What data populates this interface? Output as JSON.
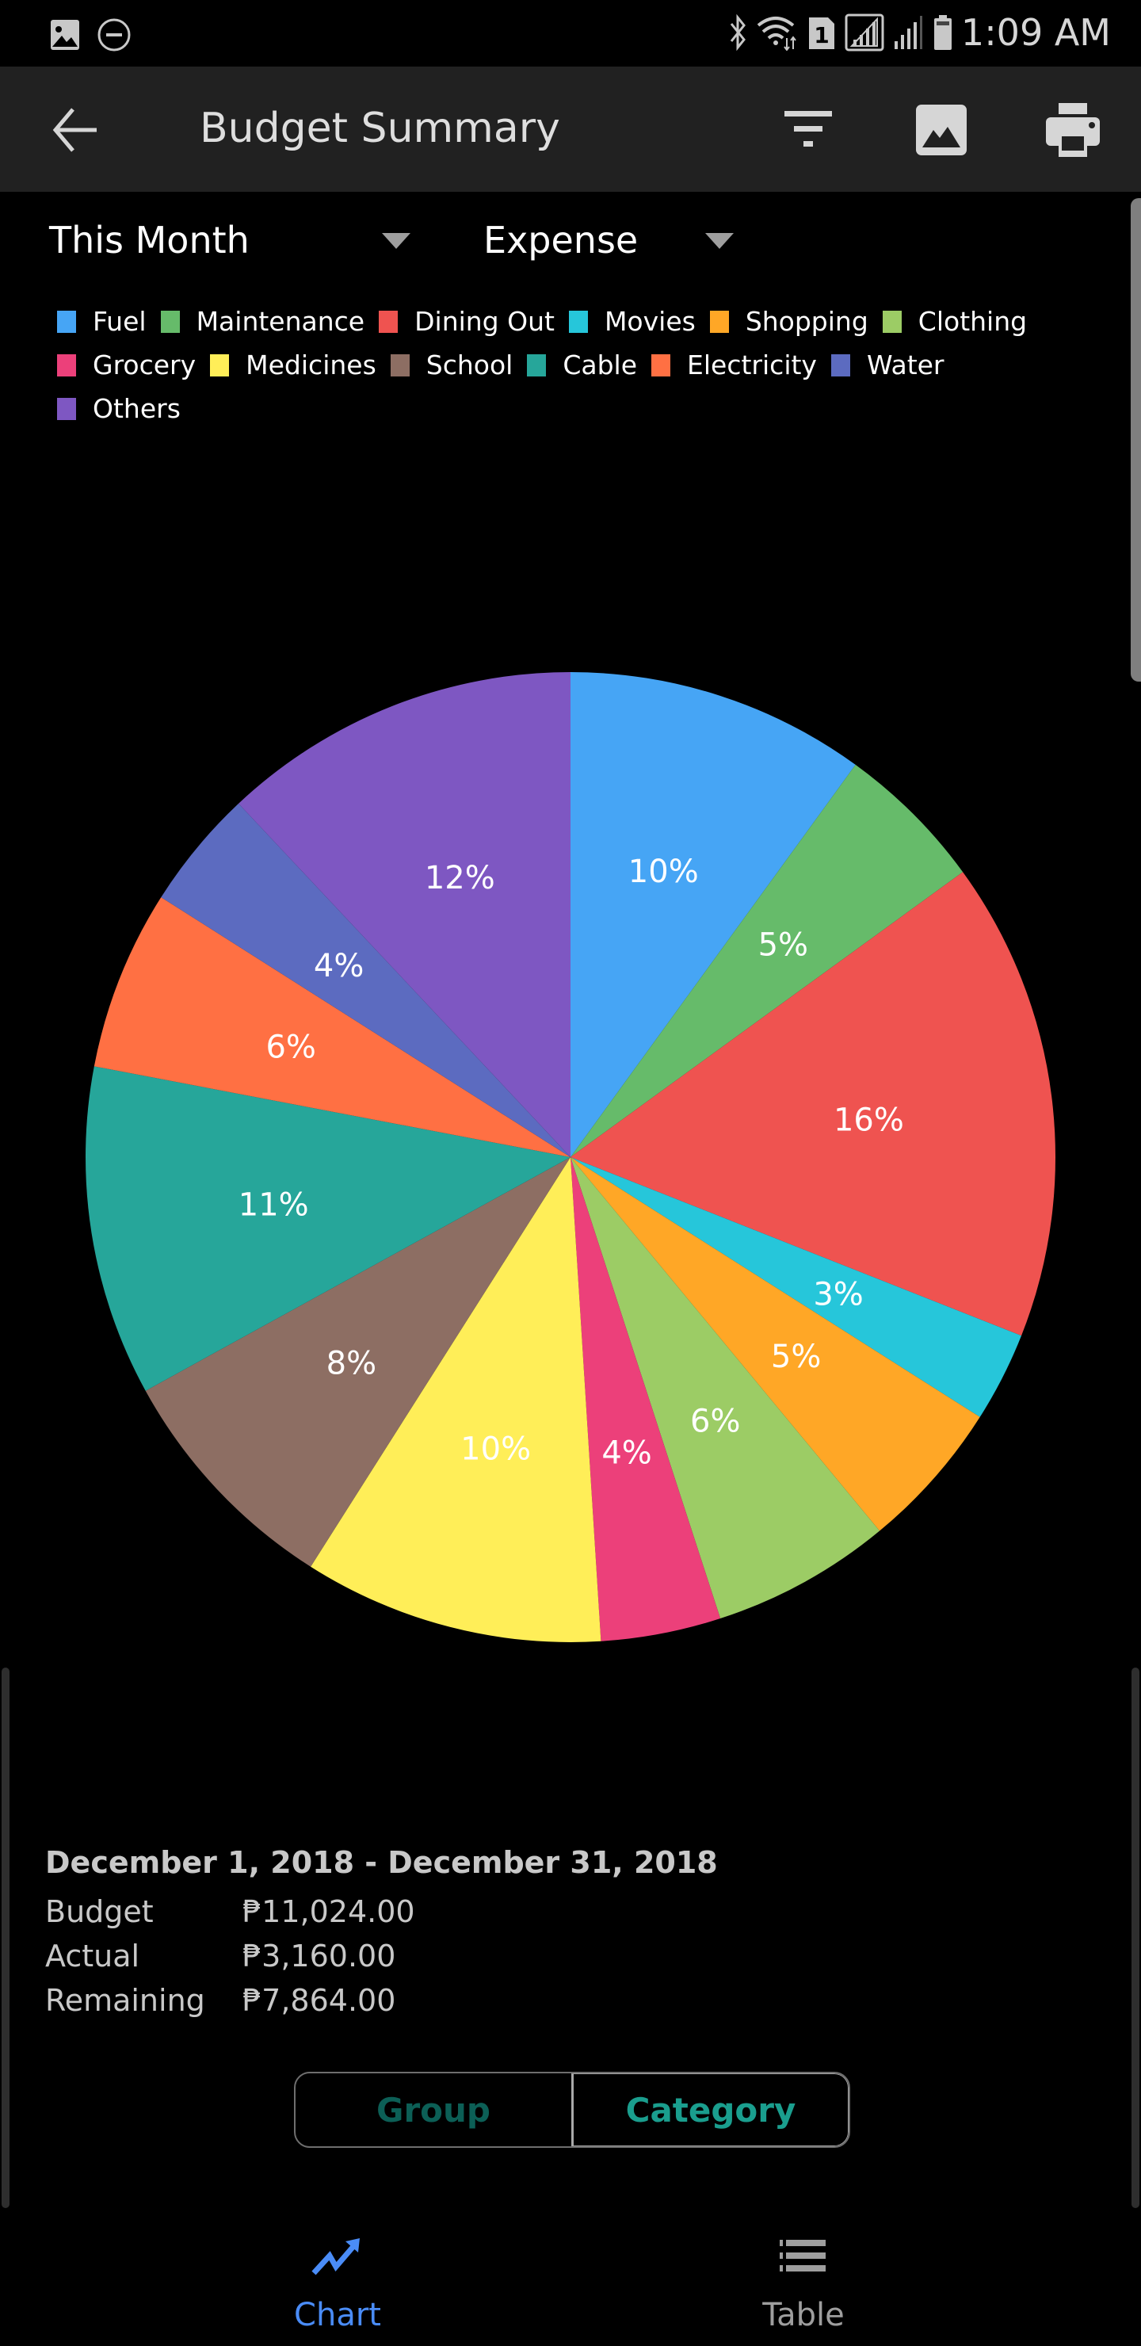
{
  "status_bar": {
    "time": "1:09 AM",
    "left_icons": [
      "gallery-notification-icon",
      "do-not-disturb-icon"
    ],
    "right_icons": [
      "bluetooth-icon",
      "wifi-icon",
      "sim-1-icon",
      "signal-icon",
      "signal-2-icon",
      "battery-icon"
    ]
  },
  "app_bar": {
    "title": "Budget Summary",
    "back_icon": "arrow-left-icon",
    "actions": [
      "filter-icon",
      "image-icon",
      "print-icon"
    ]
  },
  "filters": {
    "period": "This Month",
    "type": "Expense"
  },
  "chart_data": {
    "type": "pie",
    "title": "",
    "categories": [
      "Fuel",
      "Maintenance",
      "Dining Out",
      "Movies",
      "Shopping",
      "Clothing",
      "Grocery",
      "Medicines",
      "School",
      "Cable",
      "Electricity",
      "Water",
      "Others"
    ],
    "values": [
      10,
      5,
      16,
      3,
      5,
      6,
      4,
      10,
      8,
      11,
      6,
      4,
      12
    ],
    "labels": [
      "10%",
      "5%",
      "16%",
      "3%",
      "5%",
      "6%",
      "4%",
      "10%",
      "8%",
      "11%",
      "6%",
      "4%",
      "12%"
    ],
    "colors": [
      "#46A5F5",
      "#66BB6A",
      "#EF5350",
      "#26C6DA",
      "#FFA726",
      "#9CCC65",
      "#EC407A",
      "#FFEE58",
      "#8D6E63",
      "#26A69A",
      "#FF7043",
      "#5C6BC0",
      "#7E57C2"
    ],
    "units": "percent",
    "start": "12 o'clock, clockwise",
    "legend_position": "top"
  },
  "summary": {
    "date_range": "December 1, 2018 - December 31, 2018",
    "rows": [
      {
        "label": "Budget",
        "value": "₱11,024.00"
      },
      {
        "label": "Actual",
        "value": "₱3,160.00"
      },
      {
        "label": "Remaining",
        "value": "₱7,864.00"
      }
    ]
  },
  "segmented": {
    "options": [
      "Group",
      "Category"
    ],
    "selected": "Category"
  },
  "bottom_nav": {
    "items": [
      {
        "label": "Chart",
        "icon": "trending-up-icon",
        "active": true,
        "color": "#4A8CF7"
      },
      {
        "label": "Table",
        "icon": "list-icon",
        "active": false,
        "color": "#9e9e9e"
      }
    ]
  }
}
